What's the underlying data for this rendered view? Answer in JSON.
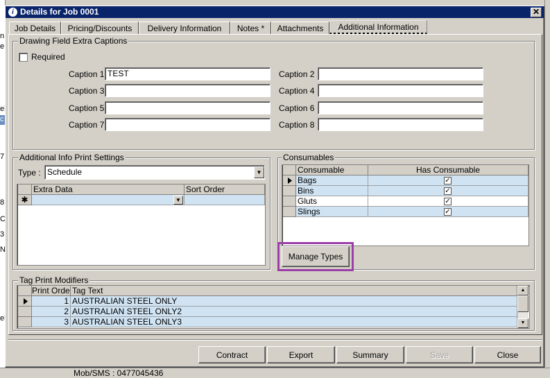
{
  "window": {
    "title": "Details for Job 0001",
    "close_glyph": "✕"
  },
  "tabs": [
    {
      "label": "Job Details"
    },
    {
      "label": "Pricing/Discounts"
    },
    {
      "label": "Delivery Information"
    },
    {
      "label": "Notes *"
    },
    {
      "label": "Attachments"
    },
    {
      "label": "Additional Information"
    }
  ],
  "drawing": {
    "title": "Drawing Field Extra Captions",
    "required_label": "Required",
    "required_checked": false,
    "captions": [
      {
        "label": "Caption 1",
        "value": "TEST"
      },
      {
        "label": "Caption 2",
        "value": ""
      },
      {
        "label": "Caption 3",
        "value": ""
      },
      {
        "label": "Caption 4",
        "value": ""
      },
      {
        "label": "Caption 5",
        "value": ""
      },
      {
        "label": "Caption 6",
        "value": ""
      },
      {
        "label": "Caption 7",
        "value": ""
      },
      {
        "label": "Caption 8",
        "value": ""
      }
    ]
  },
  "print_settings": {
    "title": "Additional Info Print Settings",
    "type_label": "Type :",
    "type_value": "Schedule",
    "columns": [
      "Extra Data",
      "Sort Order"
    ],
    "new_row_marker": "✱"
  },
  "consumables": {
    "title": "Consumables",
    "columns": [
      "Consumable",
      "Has Consumable"
    ],
    "rows": [
      {
        "name": "Bags",
        "has": true
      },
      {
        "name": "Bins",
        "has": true
      },
      {
        "name": "Gluts",
        "has": true
      },
      {
        "name": "Slings",
        "has": true
      }
    ],
    "manage_button": "Manage Types",
    "highlight_color": "#9b3fa8"
  },
  "tag_modifiers": {
    "title": "Tag Print Modifiers",
    "columns": [
      "Print Order",
      "Tag Text"
    ],
    "rows": [
      {
        "order": "1",
        "text": "AUSTRALIAN STEEL ONLY"
      },
      {
        "order": "2",
        "text": "AUSTRALIAN STEEL ONLY2"
      },
      {
        "order": "3",
        "text": "AUSTRALIAN STEEL ONLY3"
      }
    ]
  },
  "footer": {
    "buttons": [
      "Contract",
      "Export",
      "Summary",
      "Save",
      "Close"
    ]
  },
  "background": {
    "mobile_label": "Mob/SMS : 0477045436",
    "left_fragments": [
      "n",
      "e",
      "el",
      "c",
      "7",
      "8",
      "C",
      "3",
      "N",
      "el"
    ]
  }
}
